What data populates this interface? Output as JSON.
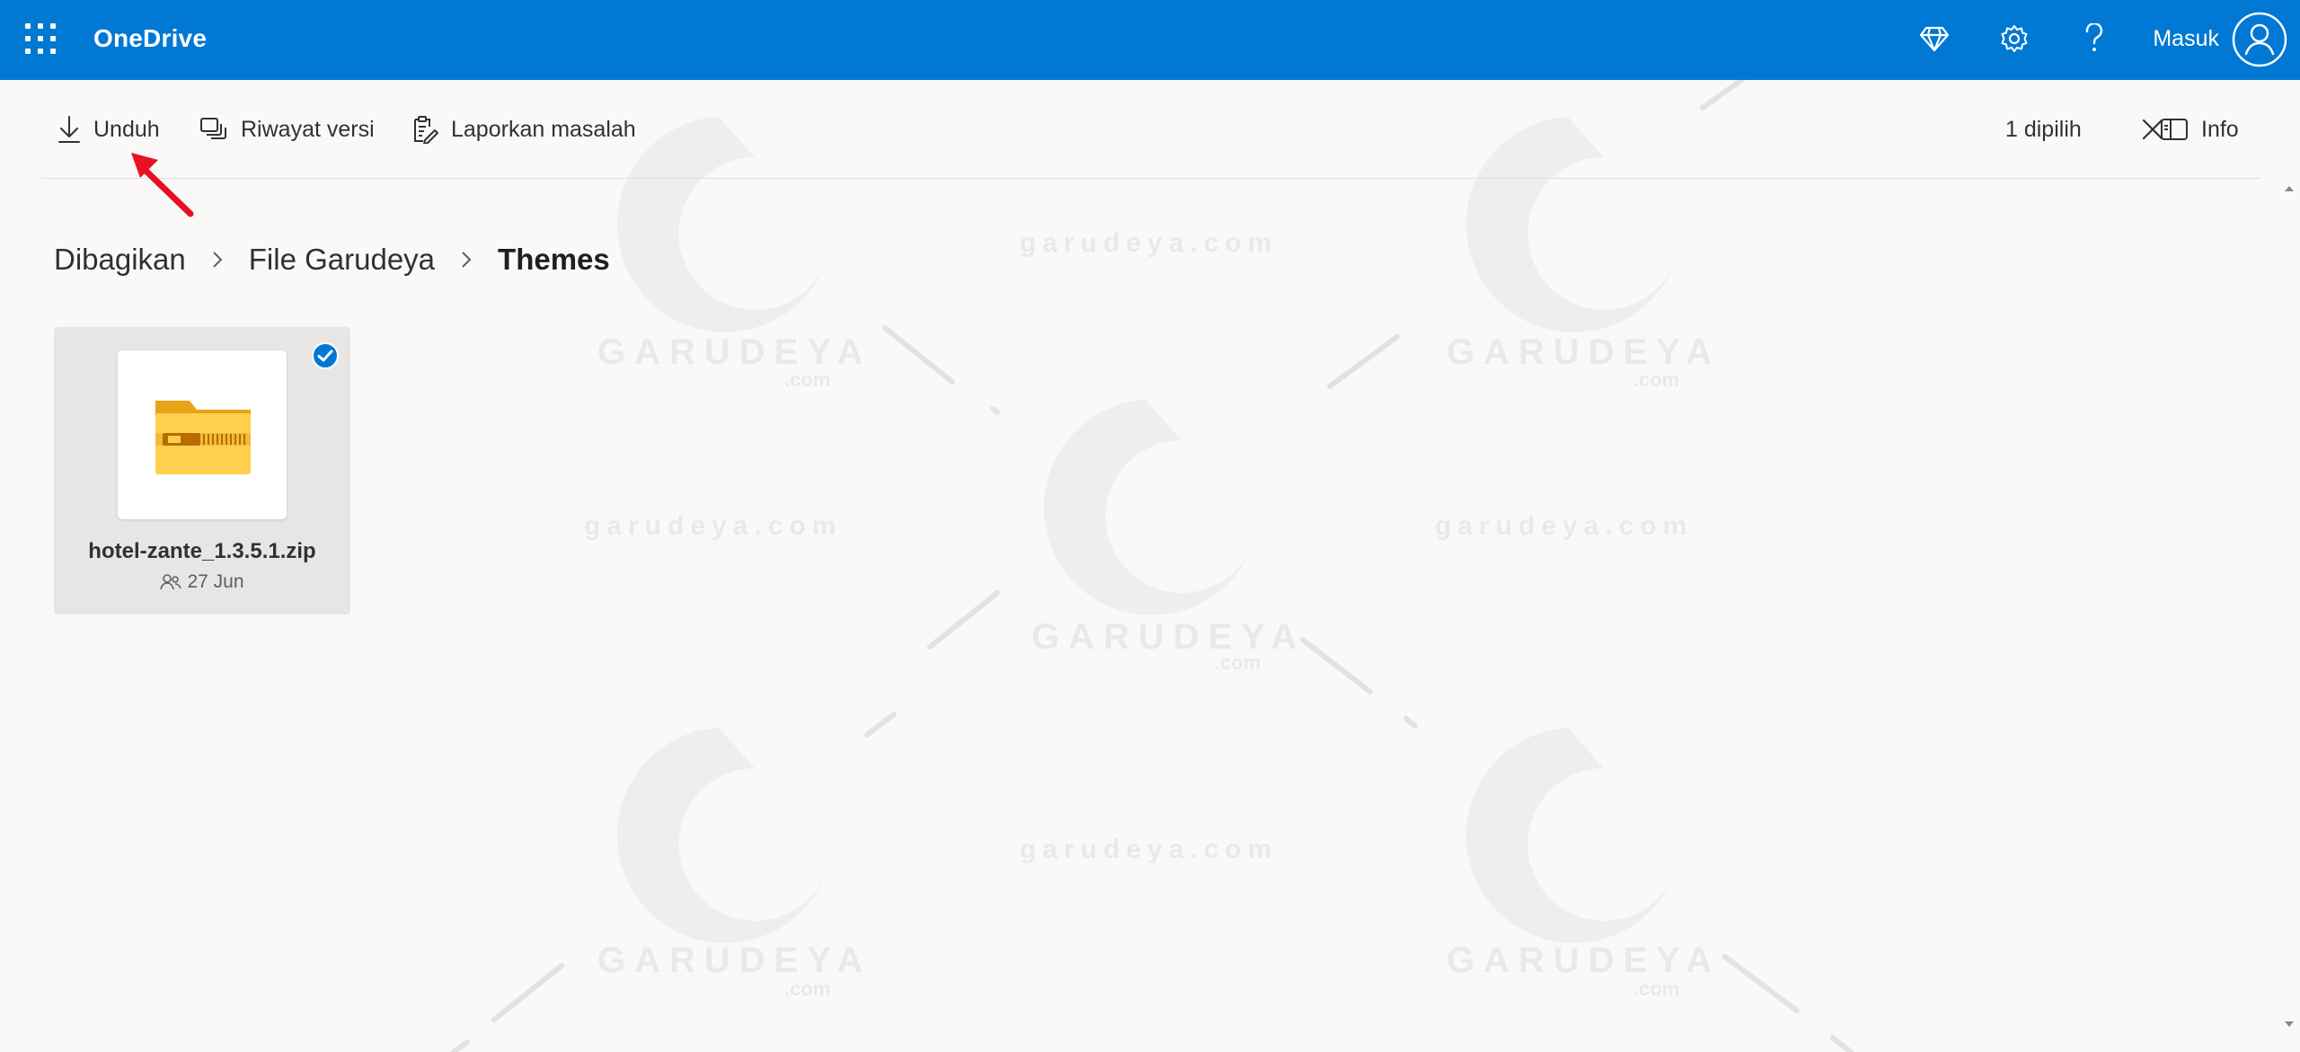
{
  "header": {
    "app_name": "OneDrive",
    "sign_in_label": "Masuk",
    "icons": [
      "app-launcher-icon",
      "premium-diamond-icon",
      "settings-gear-icon",
      "help-icon",
      "account-avatar-icon"
    ],
    "background_color": "#0078d4"
  },
  "commands": {
    "download": "Unduh",
    "version_history": "Riwayat versi",
    "report_problem": "Laporkan masalah",
    "selected_count": "1 dipilih",
    "info": "Info"
  },
  "breadcrumb": {
    "items": [
      "Dibagikan",
      "File Garudeya",
      "Themes"
    ]
  },
  "files": [
    {
      "name": "hotel-zante_1.3.5.1.zip",
      "date": "27 Jun",
      "type_icon": "zip-folder-icon",
      "shared_icon": "shared-people-icon",
      "selected": true
    }
  ],
  "watermark": {
    "brand": "GARUDEYA",
    "domain_small": ".com",
    "url": "garudeya.com"
  },
  "colors": {
    "accent": "#0078d4",
    "annotation_arrow": "#e81123",
    "background": "#faf9f8",
    "tile_selected": "#e8e6e4"
  }
}
